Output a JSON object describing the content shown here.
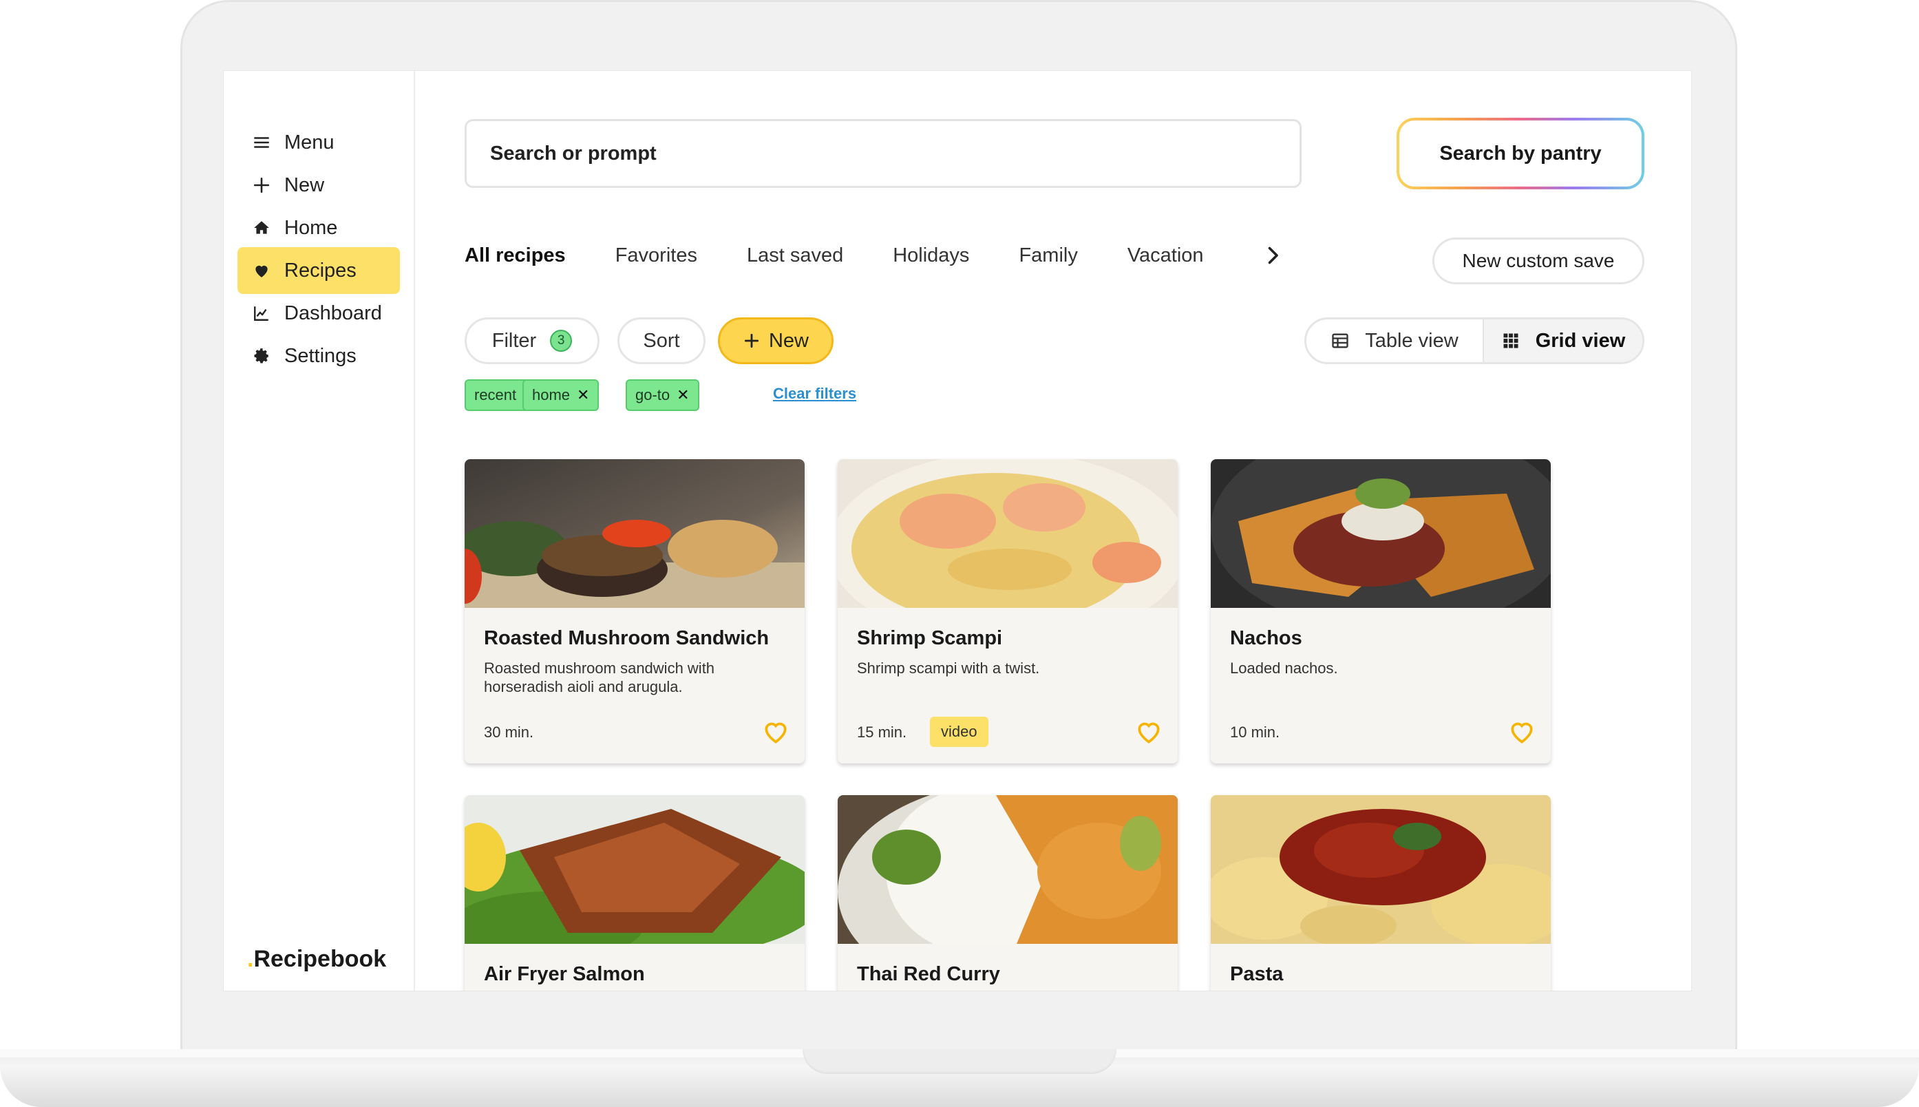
{
  "sidebar": {
    "items": [
      {
        "label": "Menu",
        "icon": "menu-icon"
      },
      {
        "label": "New",
        "icon": "plus-icon"
      },
      {
        "label": "Home",
        "icon": "home-icon"
      },
      {
        "label": "Recipes",
        "icon": "heart-icon",
        "active": true
      },
      {
        "label": "Dashboard",
        "icon": "chart-icon"
      },
      {
        "label": "Settings",
        "icon": "gear-icon"
      }
    ],
    "brand": "Recipebook",
    "brand_dot": "."
  },
  "search": {
    "placeholder": "Search or prompt"
  },
  "pantry_button": "Search by pantry",
  "tabs": [
    "All recipes",
    "Favorites",
    "Last saved",
    "Holidays",
    "Family",
    "Vacation"
  ],
  "custom_save": "New custom save",
  "toolbar": {
    "filter_label": "Filter",
    "filter_count": "3",
    "sort_label": "Sort",
    "new_label": "New",
    "table_view": "Table view",
    "grid_view": "Grid view"
  },
  "chips": [
    "recent",
    "home",
    "go-to"
  ],
  "clear_filters": "Clear filters",
  "recipes": [
    {
      "title": "Roasted Mushroom Sandwich",
      "desc": "Roasted mushroom sandwich with horseradish aioli and arugula.",
      "time": "30 min.",
      "tag": ""
    },
    {
      "title": "Shrimp Scampi",
      "desc": "Shrimp scampi with a twist.",
      "time": "15 min.",
      "tag": "video"
    },
    {
      "title": "Nachos",
      "desc": "Loaded nachos.",
      "time": "10 min.",
      "tag": ""
    },
    {
      "title": "Air Fryer Salmon",
      "desc": "",
      "time": "",
      "tag": ""
    },
    {
      "title": "Thai Red Curry",
      "desc": "",
      "time": "",
      "tag": ""
    },
    {
      "title": "Pasta",
      "desc": "",
      "time": "",
      "tag": ""
    }
  ],
  "colors": {
    "accent": "#fde067",
    "chip": "#7de78f",
    "link": "#2b8fd1",
    "heart": "#f5b400"
  }
}
